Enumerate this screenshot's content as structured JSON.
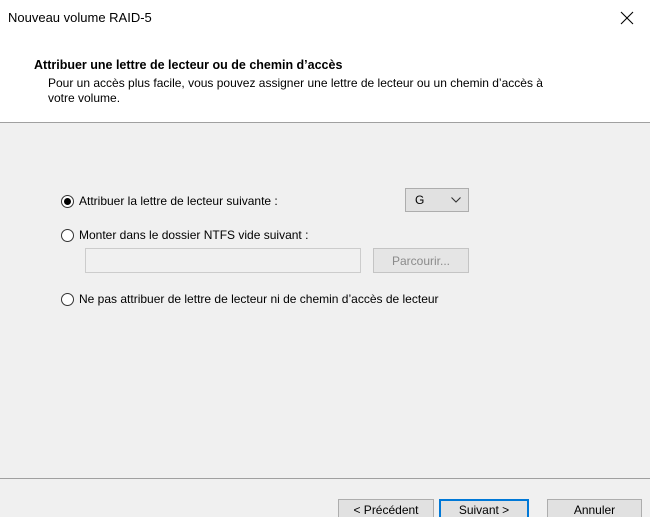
{
  "window": {
    "title": "Nouveau volume RAID-5",
    "close_icon": "close-icon"
  },
  "header": {
    "heading": "Attribuer une lettre de lecteur ou de chemin d’accès",
    "description": "Pour un accès plus facile, vous pouvez assigner une lettre de lecteur ou un chemin d’accès à votre volume."
  },
  "options": {
    "assign_letter": {
      "label": "Attribuer la lettre de lecteur suivante :",
      "checked": true,
      "selected_letter": "G"
    },
    "mount_folder": {
      "label": "Monter dans le dossier NTFS vide suivant :",
      "checked": false,
      "path_value": "",
      "browse_label": "Parcourir..."
    },
    "no_assign": {
      "label": "Ne pas attribuer de lettre de lecteur ni de chemin d’accès de lecteur",
      "checked": false
    }
  },
  "footer": {
    "back_label": "< Précédent",
    "next_label": "Suivant >",
    "cancel_label": "Annuler"
  },
  "colors": {
    "content_bg": "#f0f0f0",
    "default_button_border": "#0078d7",
    "disabled_text": "#8a8a8a"
  }
}
